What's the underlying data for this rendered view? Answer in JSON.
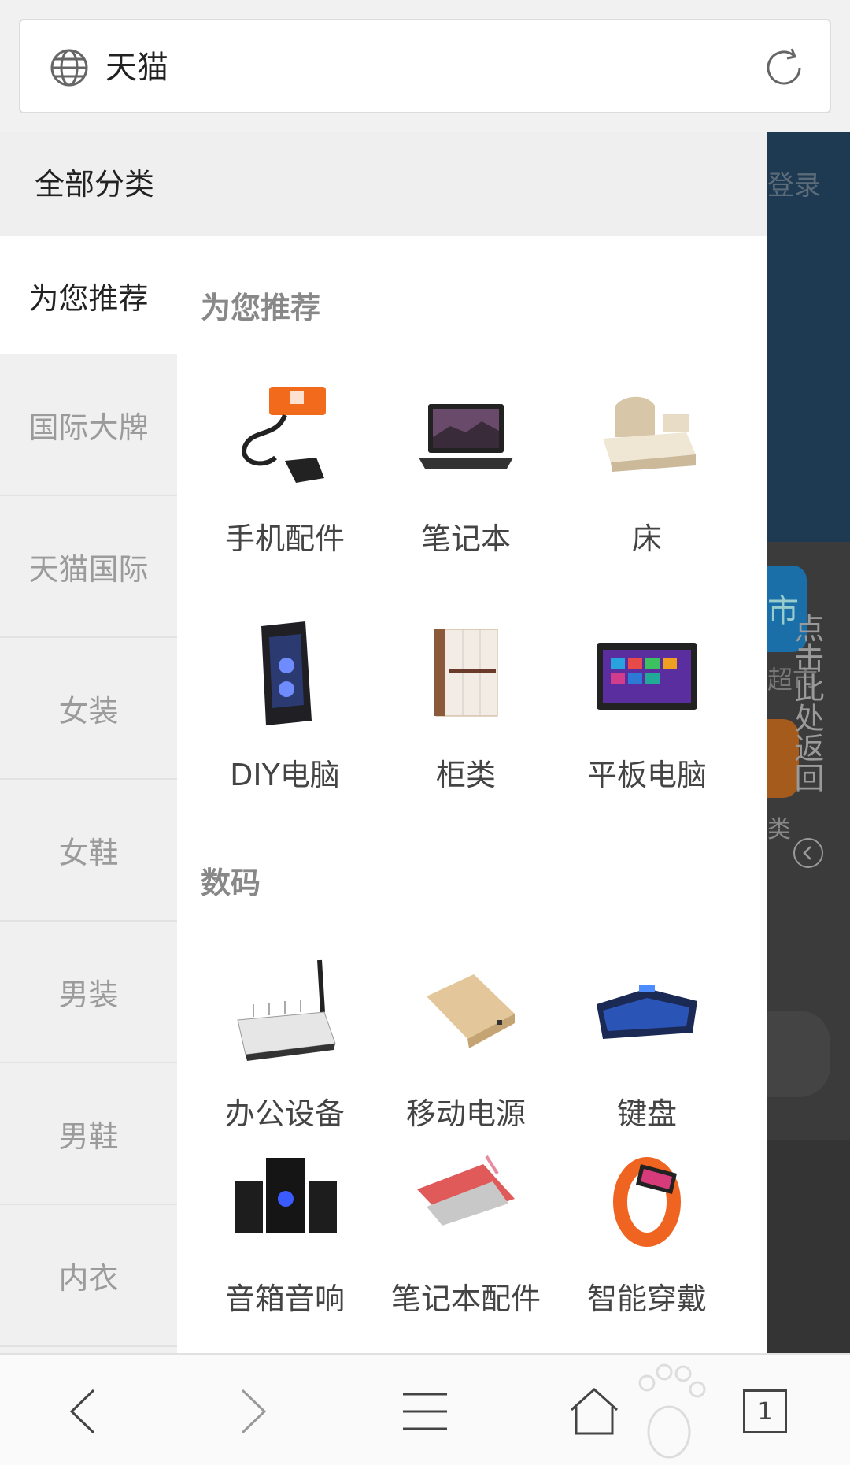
{
  "address_bar": {
    "title": "天猫"
  },
  "drawer": {
    "header_title": "全部分类",
    "sidebar_items": [
      "为您推荐",
      "国际大牌",
      "天猫国际",
      "女装",
      "女鞋",
      "男装",
      "男鞋",
      "内衣"
    ],
    "sections": [
      {
        "title": "为您推荐",
        "items": [
          {
            "label": "手机配件",
            "icon": "phone-holder"
          },
          {
            "label": "笔记本",
            "icon": "laptop"
          },
          {
            "label": "床",
            "icon": "bed"
          },
          {
            "label": "DIY电脑",
            "icon": "pc-case"
          },
          {
            "label": "柜类",
            "icon": "wardrobe"
          },
          {
            "label": "平板电脑",
            "icon": "tablet"
          }
        ]
      },
      {
        "title": "数码",
        "items": [
          {
            "label": "办公设备",
            "icon": "binding-machine"
          },
          {
            "label": "移动电源",
            "icon": "power-bank"
          },
          {
            "label": "键盘",
            "icon": "keyboard"
          },
          {
            "label": "音箱音响",
            "icon": "speaker"
          },
          {
            "label": "笔记本配件",
            "icon": "laptop-sleeve"
          },
          {
            "label": "智能穿戴",
            "icon": "smart-band"
          }
        ]
      }
    ]
  },
  "underlay": {
    "login_text": "登录",
    "chaoshi_text": "超市",
    "lei_text": "类",
    "blue_glyph": "市",
    "back_hint": "点击此处返回"
  },
  "bottom_nav": {
    "tab_count": "1",
    "items": [
      "back-icon",
      "forward-icon",
      "menu-icon",
      "home-icon",
      "tabs-icon"
    ]
  },
  "colors": {
    "accent_orange": "#f26a1b",
    "sidebar_bg": "#f0f0f0",
    "overlay_dark": "#2b2f33"
  }
}
